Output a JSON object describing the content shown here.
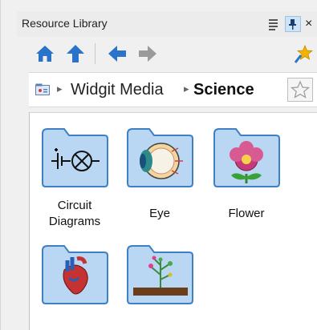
{
  "window": {
    "title": "Resource Library",
    "close_glyph": "×"
  },
  "toolbar": {
    "icons": [
      "home-icon",
      "up-arrow-icon",
      "back-arrow-icon",
      "forward-arrow-icon",
      "pin-star-icon"
    ]
  },
  "breadcrumb": {
    "items": [
      "Widgit Media",
      "Science"
    ],
    "separator": "▸"
  },
  "folders": [
    {
      "label_line1": "Circuit",
      "label_line2": "Diagrams",
      "icon": "circuit-diagram-icon"
    },
    {
      "label_line1": "Eye",
      "label_line2": "",
      "icon": "eye-icon"
    },
    {
      "label_line1": "Flower",
      "label_line2": "",
      "icon": "flower-icon"
    },
    {
      "label_line1": "",
      "label_line2": "",
      "icon": "heart-icon"
    },
    {
      "label_line1": "",
      "label_line2": "",
      "icon": "plant-icon"
    }
  ],
  "colors": {
    "folder_fill": "#b9d7f3",
    "folder_stroke": "#3f7fc4",
    "toolbar_blue": "#2b73c8"
  }
}
